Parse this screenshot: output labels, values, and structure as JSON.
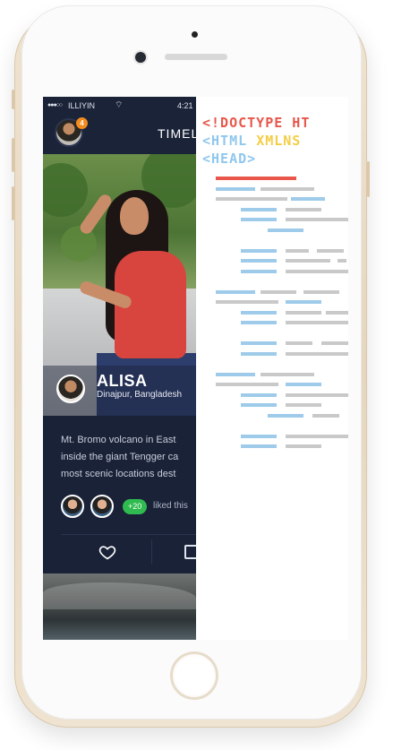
{
  "status": {
    "carrier": "ILLIYIN",
    "time": "4:21"
  },
  "nav": {
    "badge_count": "4",
    "title": "TIMEL"
  },
  "post": {
    "author_name": "ALISA",
    "author_location": "Dinajpur, Bangladesh",
    "text_lines": [
      "Mt. Bromo volcano in East",
      "inside the giant Tengger ca",
      "most scenic locations dest"
    ],
    "likes_count": "+20",
    "likes_text": "liked this"
  },
  "code": {
    "line1": "<!DOCTYPE HT",
    "line2_tag": "<HTML",
    "line2_attr": "XMLNS",
    "line3": "<HEAD>",
    "colors": {
      "doctype": "#e8574a",
      "tag": "#8fc7ee",
      "attr": "#f4cd45",
      "red_bar": "#e8574a",
      "blue_bar": "#9ecbea",
      "gray_bar": "#c9c9c9"
    }
  },
  "colors": {
    "app_bg": "#1a2238",
    "like_badge": "#2fbb4f",
    "notification_badge": "#f28c1e"
  }
}
